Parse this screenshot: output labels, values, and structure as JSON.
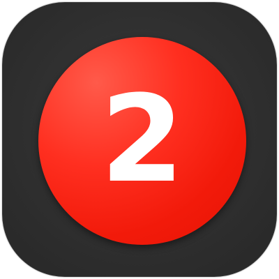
{
  "app_icon": {
    "badge": {
      "number": "2",
      "color": "#ff2f20",
      "text_color": "#ffffff"
    },
    "background_color": "#2f2f2f"
  }
}
